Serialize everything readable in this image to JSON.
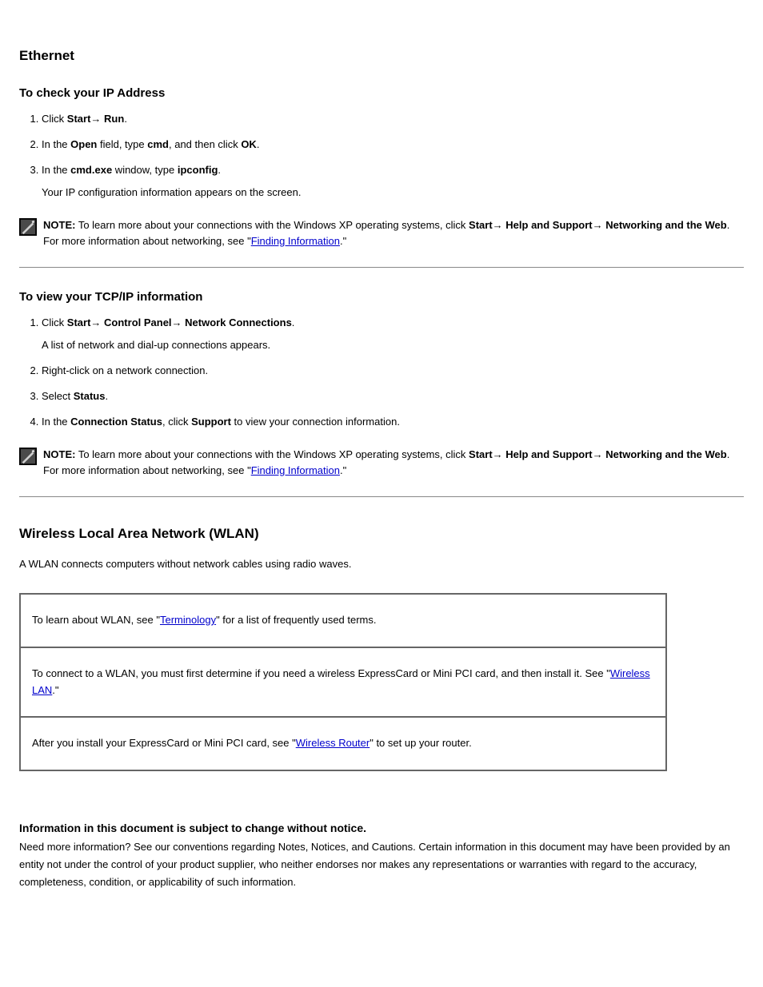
{
  "section1": {
    "heading": "Ethernet",
    "subheading": "To check your IP Address",
    "steps": [
      "Click Start→ Run.",
      "In the Open field, type cmd, and then click OK.",
      "In the cmd.exe window, type ipconfig."
    ],
    "step3_extra": "Your IP configuration information appears on the screen.",
    "note_label": "NOTE:",
    "note_body_a": " To learn more about your connections with the Windows XP operating systems, click ",
    "note_bold1": "Start",
    "note_body_b": "→ ",
    "note_bold2": "Help and Support",
    "note_body_c": "→",
    "note_bold3": "Networking and the Web",
    "note_body_d": ". For more information about networking, see \"",
    "note_link": "Finding Information",
    "note_body_e": ".\""
  },
  "section2": {
    "subheading": "To view your TCP/IP information",
    "steps": [
      "Click Start→ Control Panel→ Network Connections.",
      "Right-click on a network connection.",
      "Select Status.",
      "In the Connection Status, click Support to view your connection information."
    ],
    "step1_post": "A list of network and dial-up connections appears.",
    "note_label": "NOTE:",
    "note_body_a": " To learn more about your connections with the Windows XP operating systems, click ",
    "note_bold1": "Start",
    "note_body_b": "→ ",
    "note_bold2": "Help and Support",
    "note_body_c": "→",
    "note_bold3": "Networking and the Web",
    "note_body_d": ". For more information about networking, see \"",
    "note_link": "Finding Information",
    "note_body_e": ".\""
  },
  "section3": {
    "heading": "Wireless Local Area Network (WLAN)",
    "intro": "A WLAN connects computers without network cables using radio waves.",
    "table": [
      {
        "pre": "To learn about WLAN, see \"",
        "link": "Terminology",
        "post": "\" for a list of frequently used terms."
      },
      {
        "pre": "To connect to a WLAN, you must first determine if you need a wireless ExpressCard or Mini PCI card, and then install it. See \"",
        "link": "Wireless LAN",
        "post": ".\""
      },
      {
        "pre": "After you install your ExpressCard or Mini PCI card, see \"",
        "link": "Wireless Router",
        "post": "\" to set up your router."
      }
    ]
  },
  "footer": {
    "head": "Information in this document is subject to change without notice.",
    "body": "Need more information? See our conventions regarding Notes, Notices, and Cautions. Certain information in this document may have been provided by an entity not under the control of your product supplier, who neither endorses nor makes any representations or warranties with regard to the accuracy, completeness, condition, or applicability of such information."
  }
}
